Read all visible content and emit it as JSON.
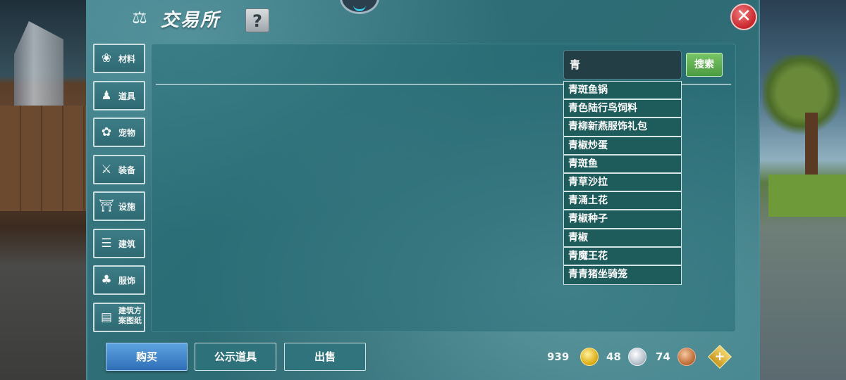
{
  "header": {
    "title": "交易所",
    "help_label": "?",
    "close_label": "✕"
  },
  "categories": [
    {
      "label": "材料",
      "icon": "materials-icon"
    },
    {
      "label": "道具",
      "icon": "item-icon"
    },
    {
      "label": "宠物",
      "icon": "paw-icon"
    },
    {
      "label": "装备",
      "icon": "equipment-icon"
    },
    {
      "label": "设施",
      "icon": "facility-icon"
    },
    {
      "label": "建筑",
      "icon": "building-icon"
    },
    {
      "label": "服饰",
      "icon": "clothing-icon"
    },
    {
      "label": "建筑方案图纸",
      "icon": "blueprint-icon"
    }
  ],
  "search": {
    "value": "青",
    "button_label": "搜索",
    "suggestions": [
      "青斑鱼锅",
      "青色陆行鸟饲料",
      "青柳新燕服饰礼包",
      "青椒炒蛋",
      "青斑鱼",
      "青草沙拉",
      "青涌土花",
      "青椒种子",
      "青椒",
      "青魔王花",
      "青青猪坐骑笼"
    ]
  },
  "tabs": [
    {
      "label": "购买",
      "active": true
    },
    {
      "label": "公示道具",
      "active": false
    },
    {
      "label": "出售",
      "active": false
    }
  ],
  "currency": {
    "gold": "939",
    "silver": "48",
    "bronze": "74"
  },
  "colors": {
    "panel": "#2f6e76",
    "active_tab": "#3f82c8",
    "search_button": "#5aaa4c",
    "close_button": "#c8242b"
  }
}
